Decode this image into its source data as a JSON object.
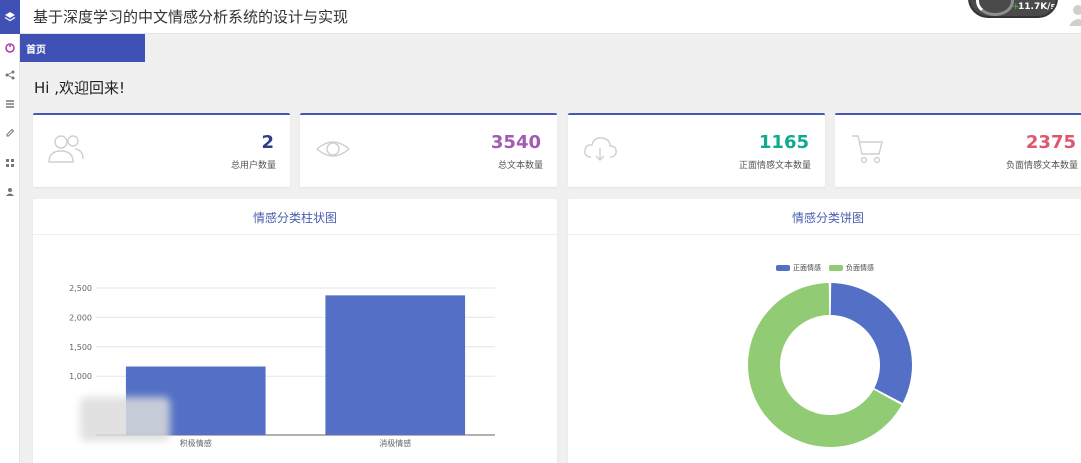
{
  "header": {
    "title": "基于深度学习的中文情感分析系统的设计与实现",
    "network_speed": "11.7K/s"
  },
  "sidebar": {
    "items": [
      {
        "icon": "palette-icon"
      },
      {
        "icon": "share-icon"
      },
      {
        "icon": "list-icon"
      },
      {
        "icon": "edit-icon"
      },
      {
        "icon": "grid-icon"
      },
      {
        "icon": "user-icon"
      }
    ]
  },
  "breadcrumb": {
    "home_label": "首页"
  },
  "welcome": "Hi ,欢迎回来!",
  "stats": [
    {
      "value": "2",
      "label": "总用户数量",
      "color": "#2f3e8c",
      "icon": "users-icon"
    },
    {
      "value": "3540",
      "label": "总文本数量",
      "color": "#a25ab2",
      "icon": "eye-icon"
    },
    {
      "value": "1165",
      "label": "正面情感文本数量",
      "color": "#11a98f",
      "icon": "cloud-download-icon"
    },
    {
      "value": "2375",
      "label": "负面情感文本数量",
      "color": "#e0566d",
      "icon": "cart-icon"
    }
  ],
  "bar_panel": {
    "title": "情感分类柱状图"
  },
  "pie_panel": {
    "title": "情感分类饼图"
  },
  "chart_data": [
    {
      "type": "bar",
      "title": "情感分类柱状图",
      "categories": [
        "积极情感",
        "消极情感"
      ],
      "values": [
        1165,
        2375
      ],
      "yticks": [
        "1,000",
        "1,500",
        "2,000",
        "2,500"
      ],
      "ylim": [
        0,
        2500
      ],
      "color": "#5470c6",
      "grid": true
    },
    {
      "type": "pie",
      "title": "情感分类饼图",
      "labels": [
        "正面情感",
        "负面情感"
      ],
      "values": [
        1165,
        2375
      ],
      "colors": [
        "#5470c6",
        "#91cc75"
      ],
      "legend": "top-center",
      "donut": true
    }
  ]
}
